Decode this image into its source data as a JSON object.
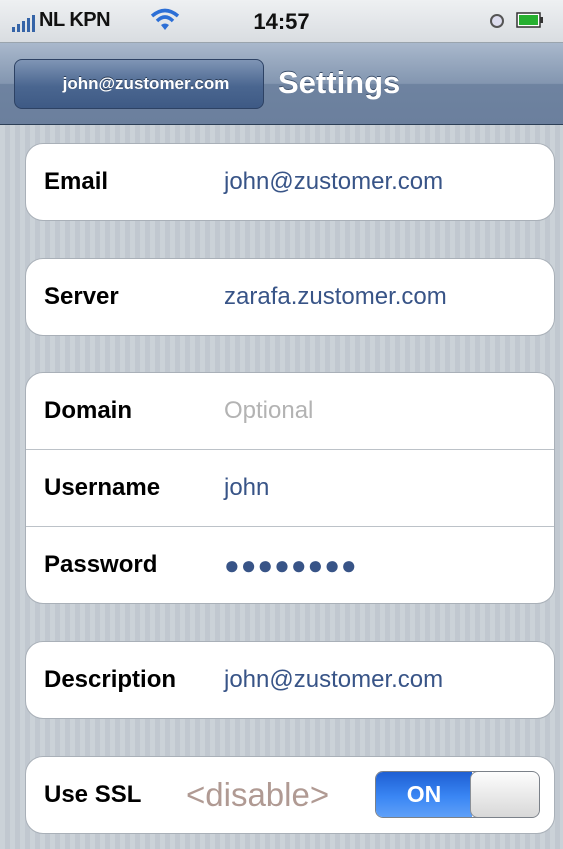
{
  "status_bar": {
    "carrier": "NL KPN",
    "time": "14:57"
  },
  "navbar": {
    "back_label": "john@zustomer.com",
    "title": "Settings"
  },
  "groups": [
    {
      "rows": [
        {
          "label": "Email",
          "value": "john@zustomer.com"
        }
      ]
    },
    {
      "rows": [
        {
          "label": "Server",
          "value": "zarafa.zustomer.com"
        }
      ]
    },
    {
      "rows": [
        {
          "label": "Domain",
          "placeholder": "Optional"
        },
        {
          "label": "Username",
          "value": "john"
        },
        {
          "label": "Password",
          "value": "●●●●●●●●"
        }
      ]
    },
    {
      "rows": [
        {
          "label": "Description",
          "value": "john@zustomer.com"
        }
      ]
    },
    {
      "rows": [
        {
          "label": "Use SSL",
          "hint": "<disable>",
          "toggle_label": "ON",
          "toggle_on": true
        }
      ]
    }
  ],
  "colors": {
    "accent_blue": "#385487",
    "toggle_on": "#2f76ea",
    "nav_bar": "#8396b0"
  },
  "icons": [
    "signal-icon",
    "wifi-icon",
    "clock-icon",
    "battery-icon"
  ]
}
